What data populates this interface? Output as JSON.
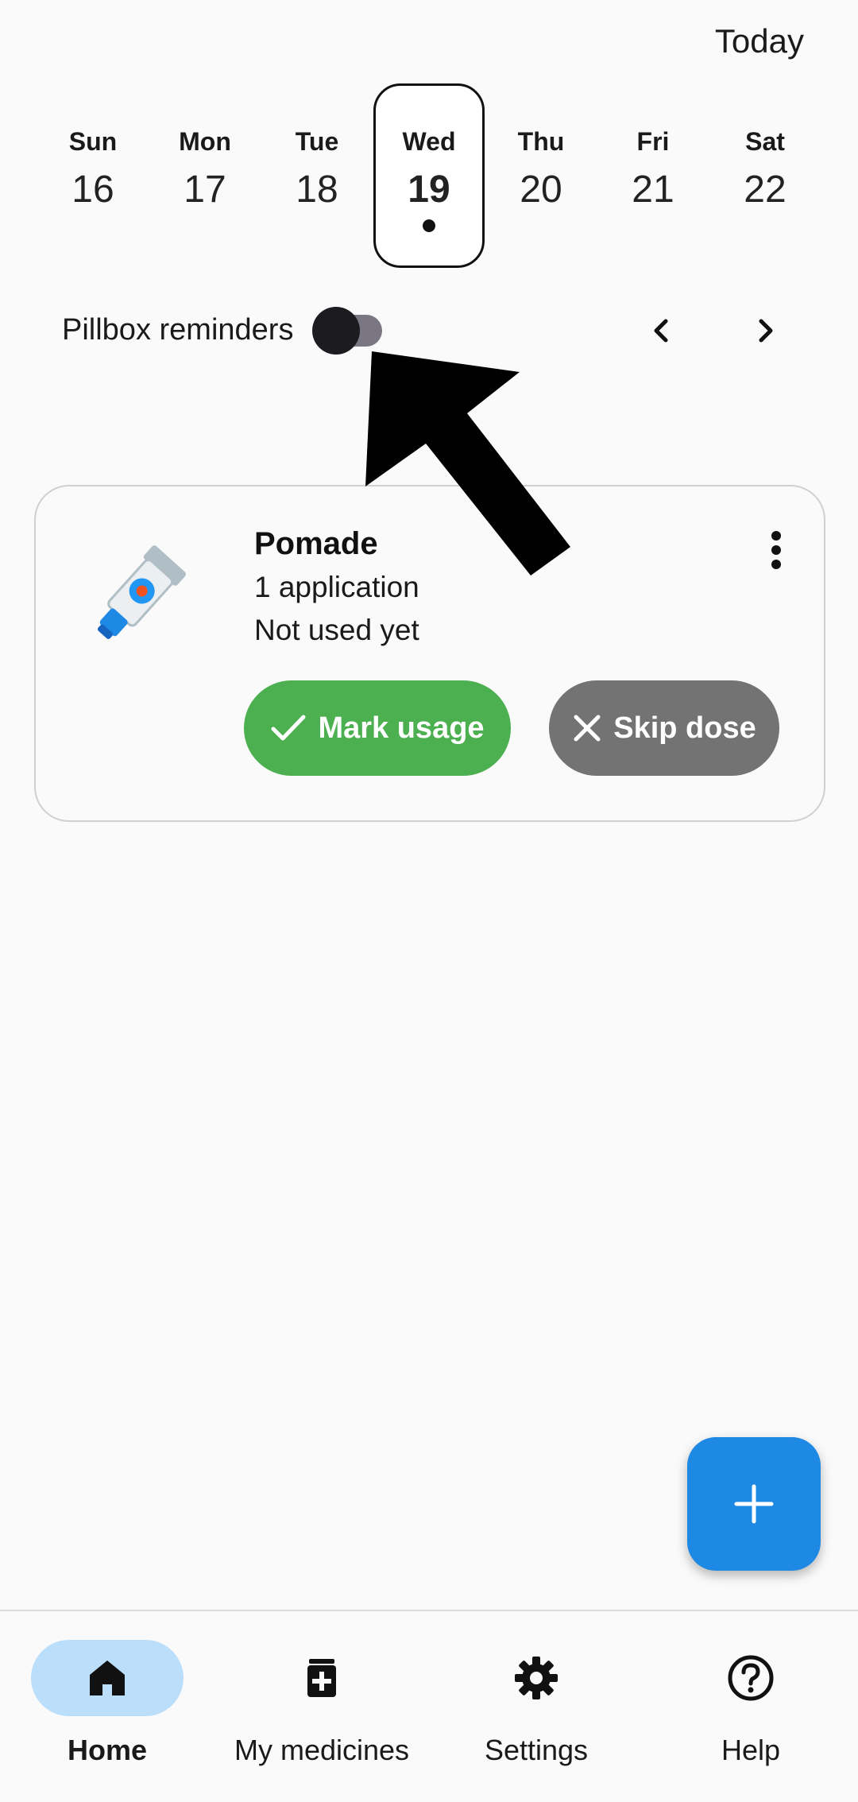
{
  "header": {
    "today_label": "Today"
  },
  "week": [
    {
      "day": "Sun",
      "date": "16"
    },
    {
      "day": "Mon",
      "date": "17"
    },
    {
      "day": "Tue",
      "date": "18"
    },
    {
      "day": "Wed",
      "date": "19",
      "selected": true,
      "has_dose": true
    },
    {
      "day": "Thu",
      "date": "20"
    },
    {
      "day": "Fri",
      "date": "21"
    },
    {
      "day": "Sat",
      "date": "22"
    }
  ],
  "pillbox": {
    "label": "Pillbox reminders",
    "enabled": false
  },
  "card": {
    "name": "Pomade",
    "dose": "1 application",
    "status": "Not used yet",
    "icon": "ointment-tube-icon",
    "mark_label": "Mark usage",
    "skip_label": "Skip dose"
  },
  "bottom_nav": [
    {
      "label": "Home",
      "icon": "home-icon",
      "active": true
    },
    {
      "label": "My medicines",
      "icon": "medicine-box-icon"
    },
    {
      "label": "Settings",
      "icon": "gear-icon"
    },
    {
      "label": "Help",
      "icon": "help-icon"
    }
  ],
  "colors": {
    "accent": "#1e88e5",
    "mark_button": "#4caf50",
    "skip_button": "#737373",
    "nav_active": "#bbdefb"
  }
}
